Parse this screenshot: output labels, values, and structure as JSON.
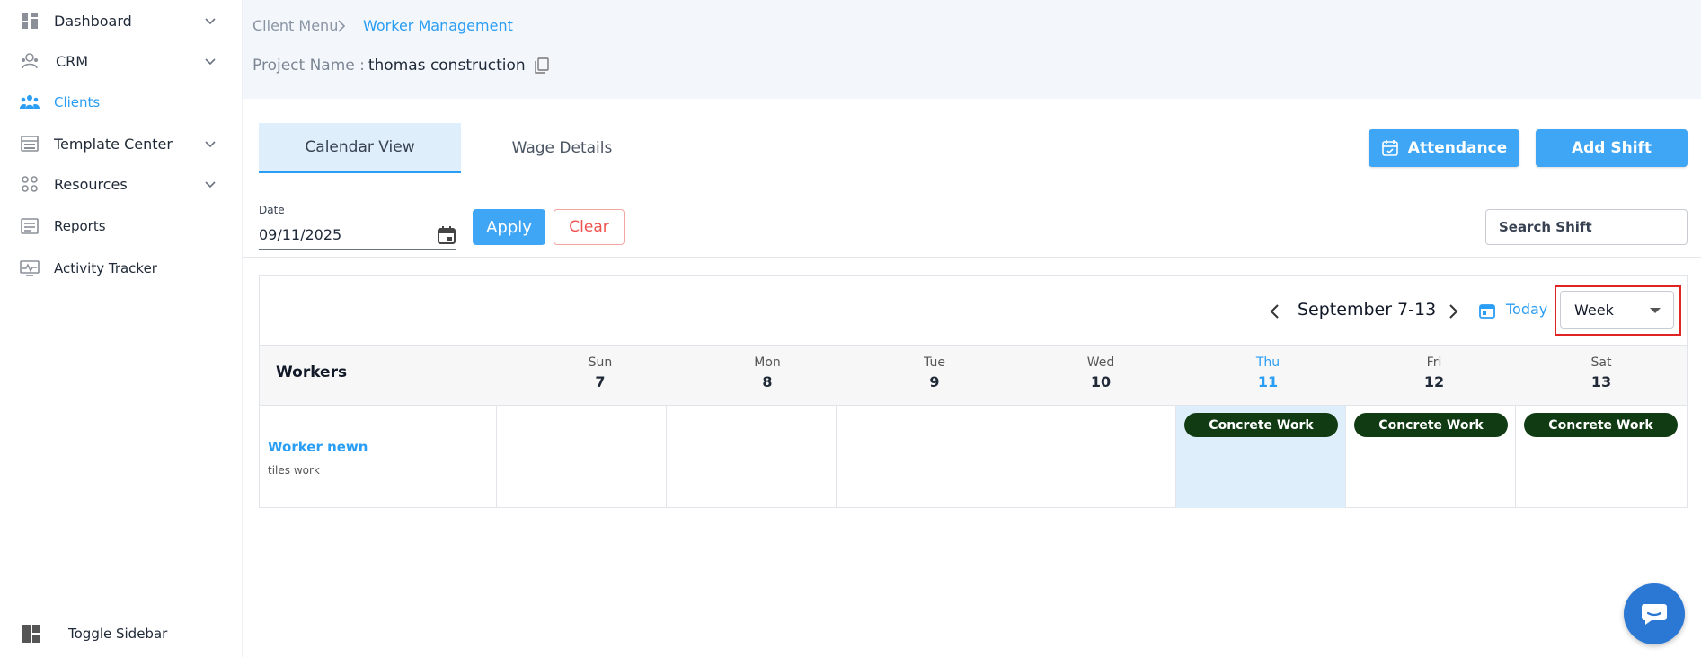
{
  "sidebar": {
    "items": [
      {
        "label": "Dashboard",
        "icon": "dashboard-icon",
        "has_chevron": true
      },
      {
        "label": "CRM",
        "icon": "crm-icon",
        "has_chevron": true
      },
      {
        "label": "Clients",
        "icon": "clients-icon",
        "active": true
      },
      {
        "label": "Template Center",
        "icon": "template-icon",
        "has_chevron": true
      },
      {
        "label": "Resources",
        "icon": "resources-icon",
        "has_chevron": true
      },
      {
        "label": "Reports",
        "icon": "reports-icon"
      },
      {
        "label": "Activity Tracker",
        "icon": "activity-icon"
      }
    ],
    "toggle_label": "Toggle Sidebar"
  },
  "breadcrumb": {
    "root": "Client Menu",
    "current": "Worker Management"
  },
  "project": {
    "key": "Project Name :",
    "value": "thomas construction"
  },
  "tabs": [
    {
      "label": "Calendar View",
      "active": true
    },
    {
      "label": "Wage Details",
      "active": false
    }
  ],
  "actions": {
    "attendance_label": "Attendance",
    "add_shift_label": "Add Shift"
  },
  "filters": {
    "date_label": "Date",
    "date_value": "09/11/2025",
    "apply_label": "Apply",
    "clear_label": "Clear",
    "search_placeholder": "Search Shift"
  },
  "calendar": {
    "range_label": "September 7-13",
    "today_label": "Today",
    "view_value": "Week",
    "workers_header": "Workers",
    "days": [
      {
        "name": "Sun",
        "num": "7"
      },
      {
        "name": "Mon",
        "num": "8"
      },
      {
        "name": "Tue",
        "num": "9"
      },
      {
        "name": "Wed",
        "num": "10"
      },
      {
        "name": "Thu",
        "num": "11",
        "today": true
      },
      {
        "name": "Fri",
        "num": "12"
      },
      {
        "name": "Sat",
        "num": "13"
      }
    ],
    "workers": [
      {
        "name": "Worker newn",
        "role": "tiles work",
        "shifts": [
          "",
          "",
          "",
          "",
          "Concrete Work",
          "Concrete Work",
          "Concrete Work"
        ]
      }
    ]
  },
  "colors": {
    "accent": "#2a9df4",
    "primary_button": "#3ea6f5",
    "shift_pill": "#113b12",
    "highlight_box": "#e02424",
    "today_bg": "#deeefb"
  }
}
